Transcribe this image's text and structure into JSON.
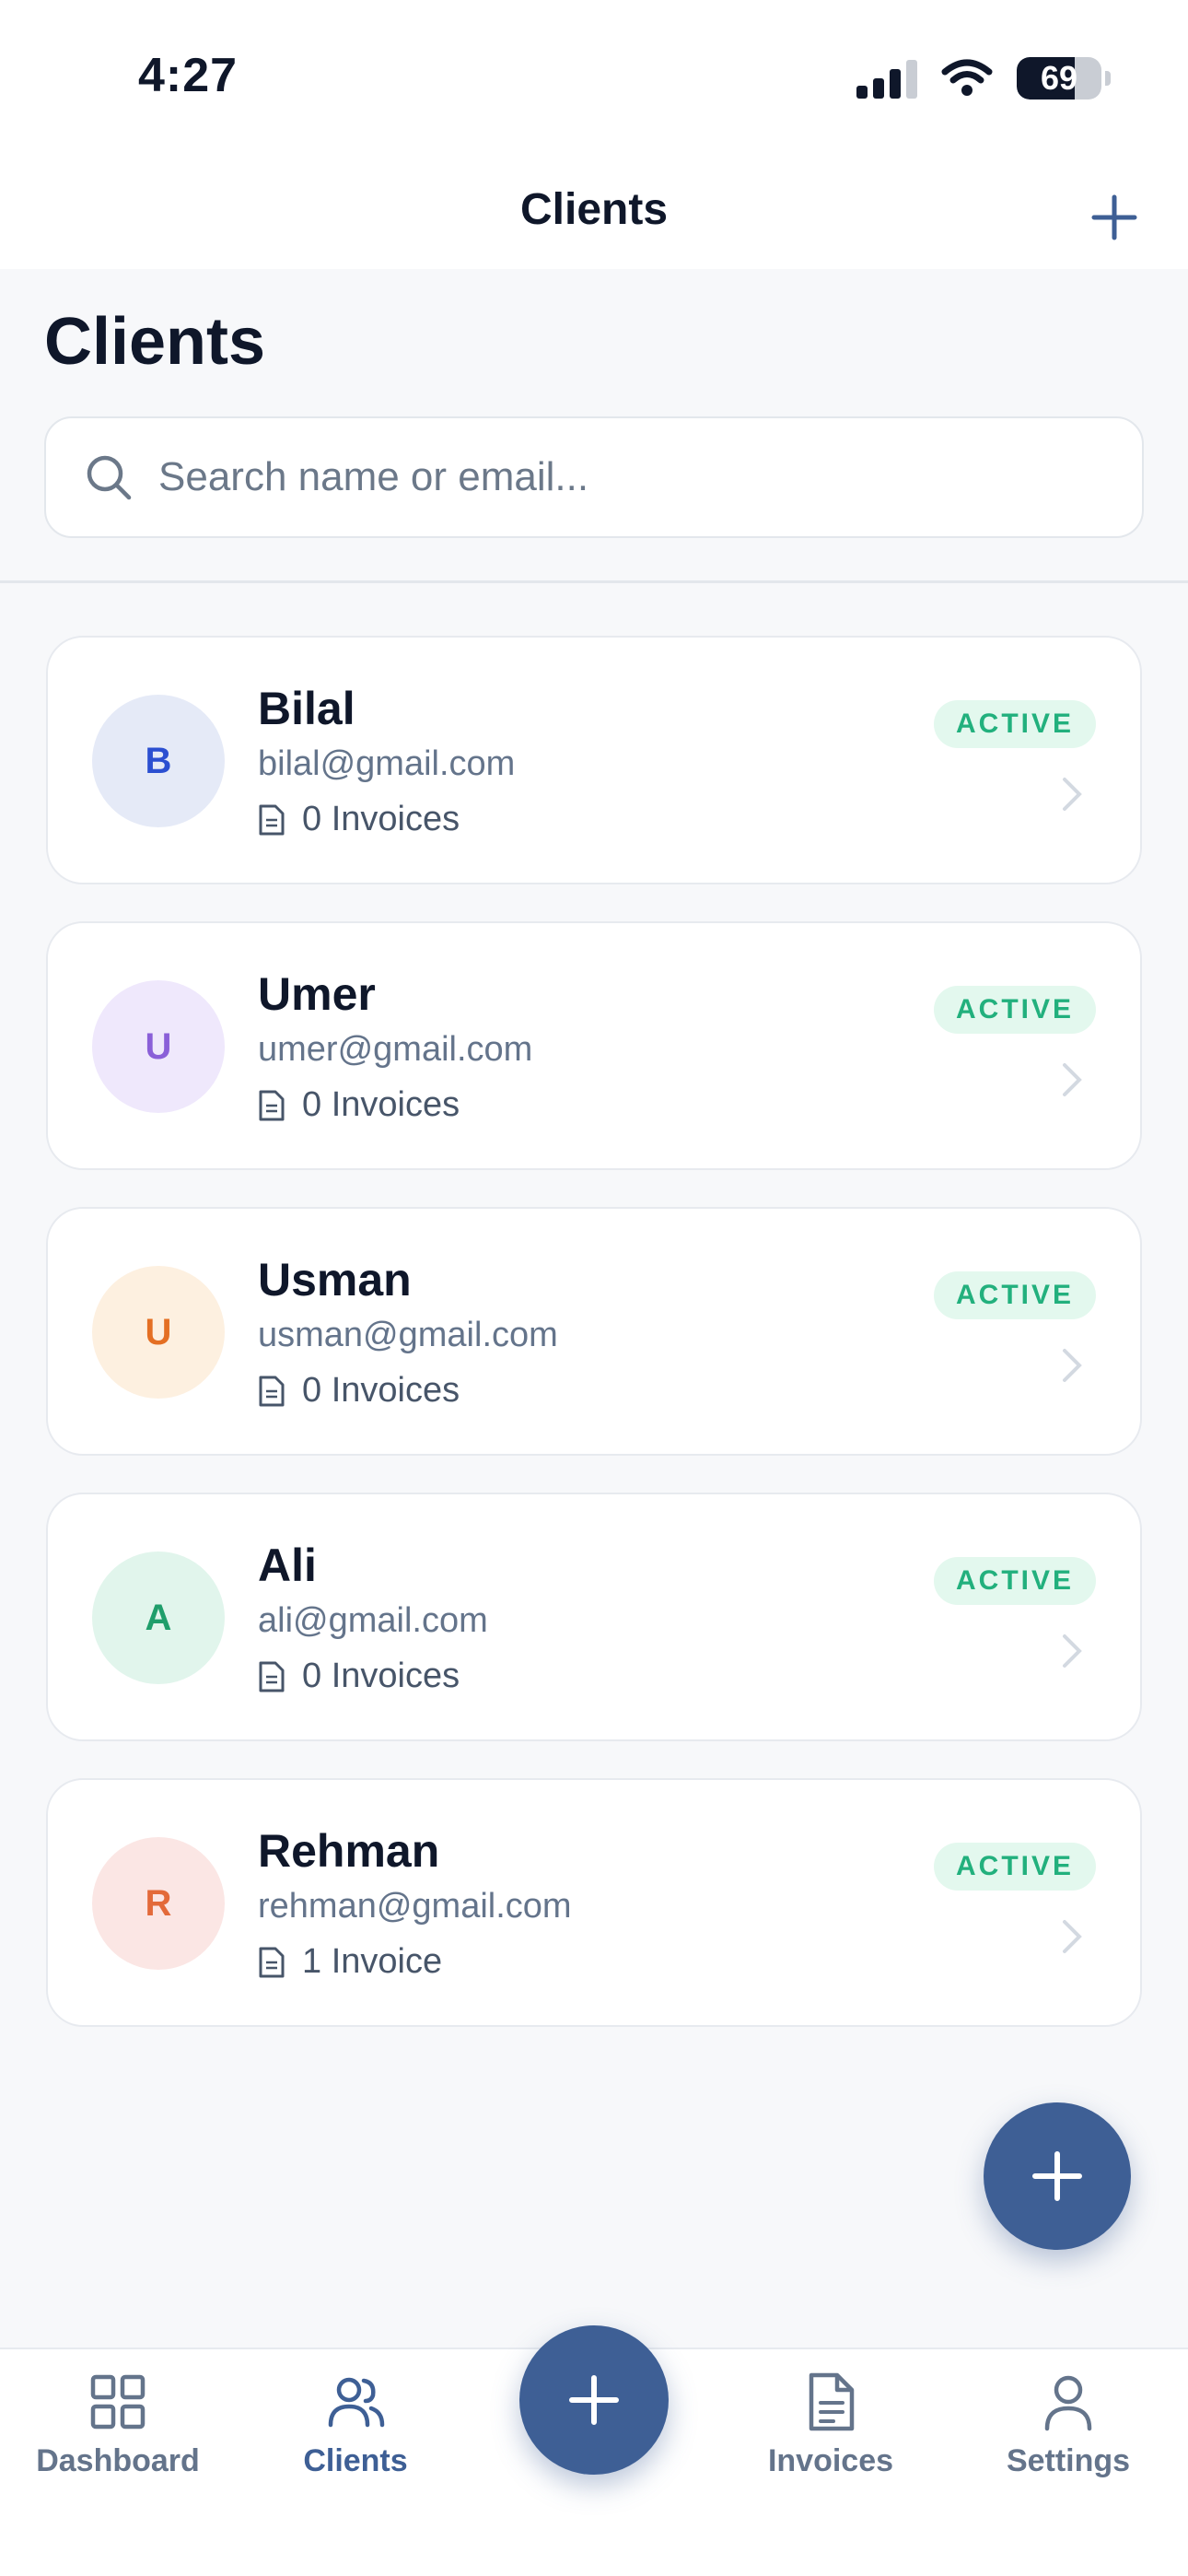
{
  "status_bar": {
    "time": "4:27",
    "battery": "69",
    "battery_level": 0.69
  },
  "nav": {
    "title": "Clients",
    "add_icon": "plus-icon"
  },
  "page": {
    "title": "Clients"
  },
  "search": {
    "placeholder": "Search name or email...",
    "icon": "search-icon"
  },
  "clients": [
    {
      "initial": "B",
      "name": "Bilal",
      "email": "bilal@gmail.com",
      "invoices": "0 Invoices",
      "status": "ACTIVE",
      "avatar_bg": "#e5eaf7",
      "avatar_fg": "#2b4fd1"
    },
    {
      "initial": "U",
      "name": "Umer",
      "email": "umer@gmail.com",
      "invoices": "0 Invoices",
      "status": "ACTIVE",
      "avatar_bg": "#efe8fc",
      "avatar_fg": "#8a5fd8"
    },
    {
      "initial": "U",
      "name": "Usman",
      "email": "usman@gmail.com",
      "invoices": "0 Invoices",
      "status": "ACTIVE",
      "avatar_bg": "#fdf0e0",
      "avatar_fg": "#e46f23"
    },
    {
      "initial": "A",
      "name": "Ali",
      "email": "ali@gmail.com",
      "invoices": "0 Invoices",
      "status": "ACTIVE",
      "avatar_bg": "#e1f5ec",
      "avatar_fg": "#1f9e6b"
    },
    {
      "initial": "R",
      "name": "Rehman",
      "email": "rehman@gmail.com",
      "invoices": "1 Invoice",
      "status": "ACTIVE",
      "avatar_bg": "#fbe6e4",
      "avatar_fg": "#e36a3a"
    }
  ],
  "tabs": [
    {
      "label": "Dashboard",
      "icon": "dashboard-icon",
      "active": false
    },
    {
      "label": "Clients",
      "icon": "users-icon",
      "active": true
    },
    {
      "label": "Invoices",
      "icon": "invoice-icon",
      "active": false
    },
    {
      "label": "Settings",
      "icon": "user-icon",
      "active": false
    }
  ],
  "colors": {
    "accent": "#3e5f95",
    "badge_bg": "#e3f8ee",
    "badge_fg": "#22b07d"
  }
}
